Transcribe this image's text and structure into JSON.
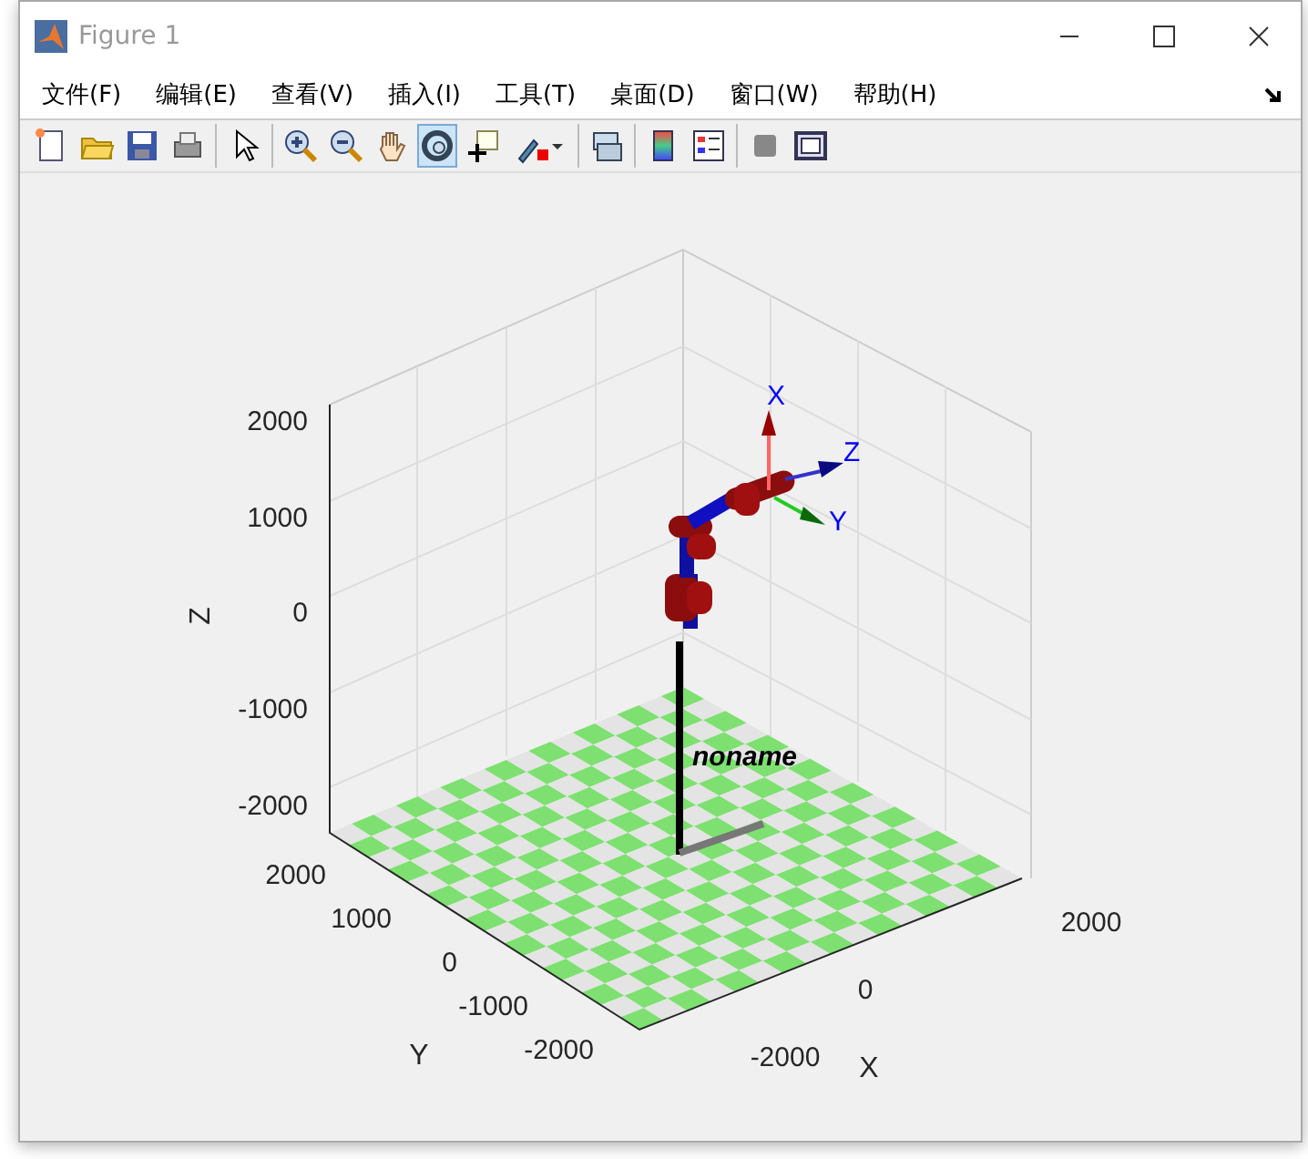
{
  "window": {
    "title": "Figure 1"
  },
  "menu": [
    "文件(F)",
    "编辑(E)",
    "查看(V)",
    "插入(I)",
    "工具(T)",
    "桌面(D)",
    "窗口(W)",
    "帮助(H)"
  ],
  "toolbar": [
    [
      {
        "kind": "new",
        "selected": false
      },
      {
        "kind": "open",
        "selected": false
      },
      {
        "kind": "save",
        "selected": false
      },
      {
        "kind": "print",
        "selected": false
      }
    ],
    [
      {
        "kind": "pointer",
        "selected": false
      }
    ],
    [
      {
        "kind": "zoom-in",
        "selected": false
      },
      {
        "kind": "zoom-out",
        "selected": false
      },
      {
        "kind": "pan",
        "selected": false
      },
      {
        "kind": "rotate",
        "selected": true
      },
      {
        "kind": "datatip",
        "selected": false
      },
      {
        "kind": "brush",
        "selected": false
      }
    ],
    [
      {
        "kind": "link",
        "selected": false
      }
    ],
    [
      {
        "kind": "colorbar",
        "selected": false
      },
      {
        "kind": "legend",
        "selected": false
      }
    ],
    [
      {
        "kind": "hide",
        "selected": false
      },
      {
        "kind": "dock",
        "selected": false
      }
    ]
  ],
  "plot": {
    "z_label": "Z",
    "y_label": "Y",
    "x_label": "X",
    "z_ticks": [
      "2000",
      "1000",
      "0",
      "-1000",
      "-2000"
    ],
    "y_ticks": [
      "2000",
      "1000",
      "0",
      "-1000",
      "-2000"
    ],
    "x_ticks": [
      "-2000",
      "0",
      "2000"
    ],
    "robot_name": "noname",
    "frame_labels": [
      "X",
      "Z",
      "Y"
    ]
  }
}
